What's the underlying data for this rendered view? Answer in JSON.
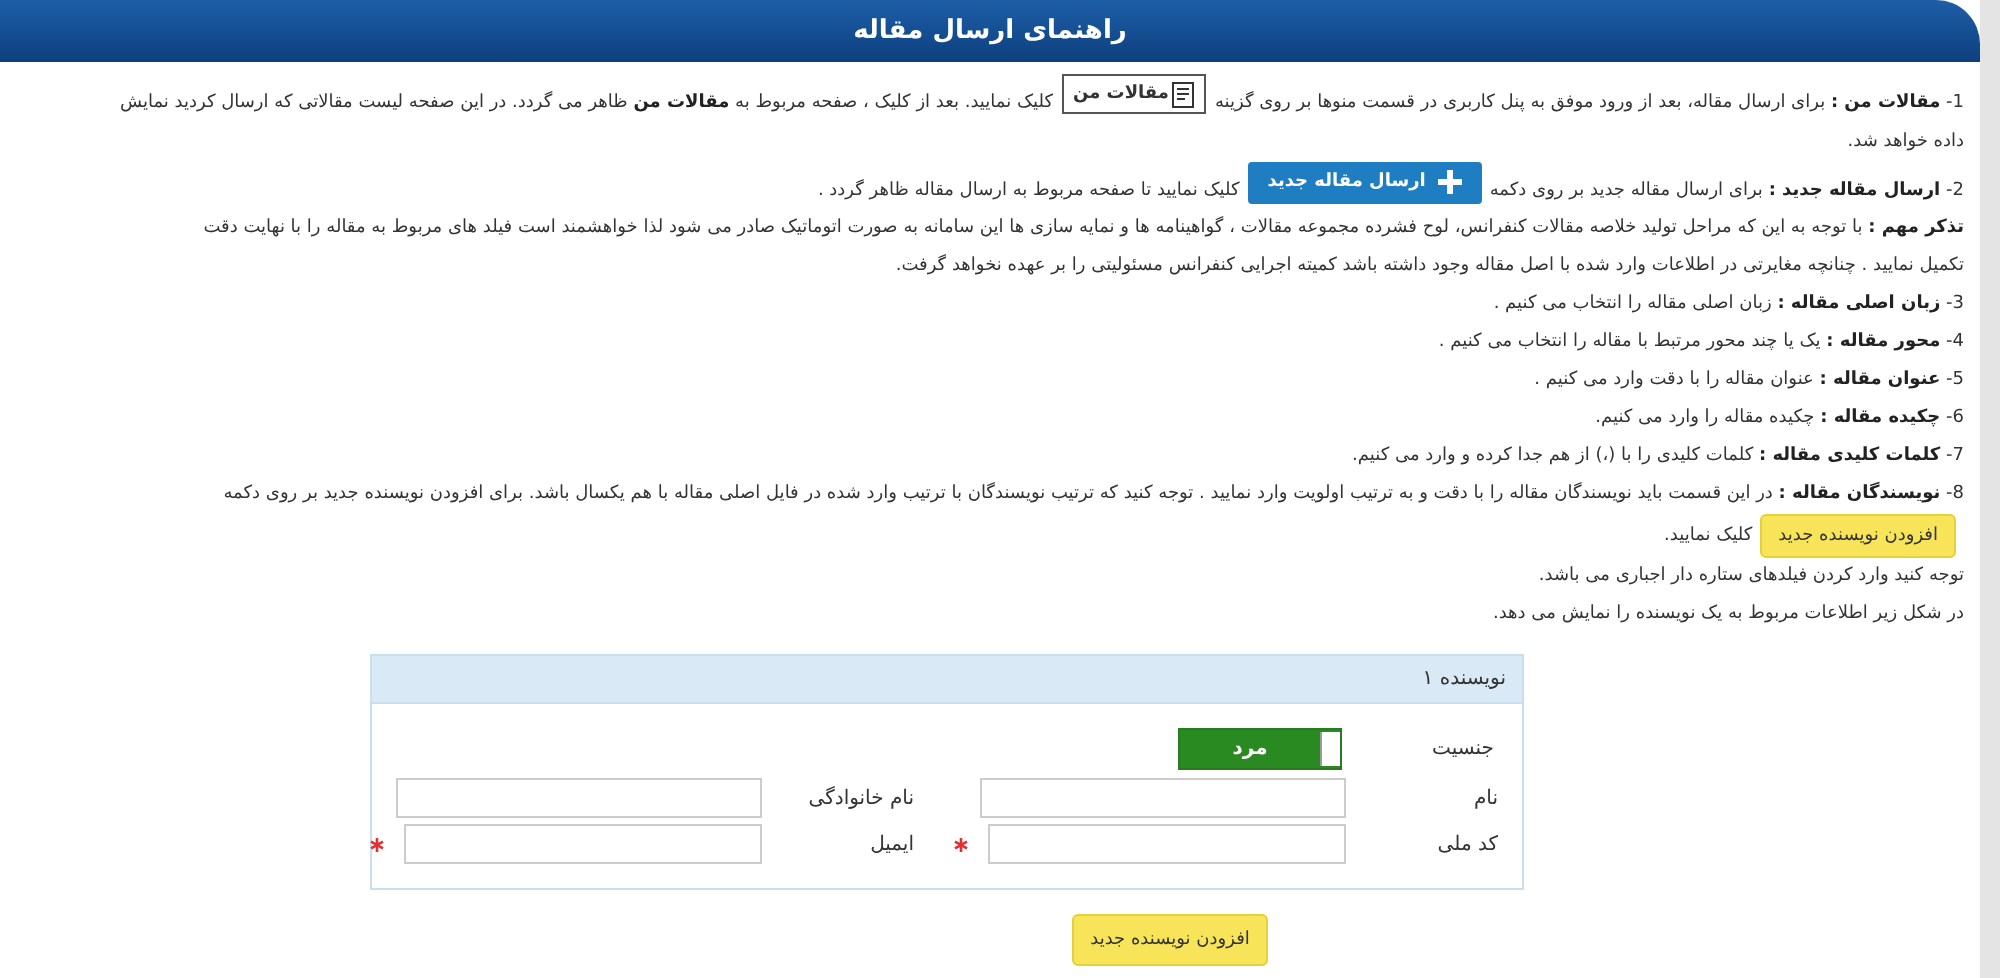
{
  "header": {
    "title": "راهنمای ارسال مقاله"
  },
  "paragraphs": [
    {
      "parts": [
        {
          "kind": "text",
          "text": "1- **مقالات من :** برای ارسال مقاله، بعد از ورود موفق به پنل کاربری در قسمت منوها بر روی گزینه"
        },
        {
          "kind": "menu-button",
          "text": "مقالات من"
        },
        {
          "kind": "text",
          "text": "کلیک نمایید. بعد از کلیک ، صفحه مربوط به **مقالات من** ظاهر می گردد. در این صفحه لیست مقالاتی که ارسال کردید نمایش"
        },
        {
          "kind": "break"
        },
        {
          "kind": "text",
          "text": "داده خواهد شد."
        }
      ]
    },
    {
      "parts": [
        {
          "kind": "text",
          "text": "2- **ارسال مقاله جدید :** برای ارسال مقاله جدید بر روی دکمه"
        },
        {
          "kind": "primary-button",
          "text": "ارسال مقاله جدید"
        },
        {
          "kind": "text",
          "text": "کلیک نمایید تا صفحه مربوط به ارسال مقاله ظاهر گردد ."
        }
      ]
    },
    {
      "parts": [
        {
          "kind": "text",
          "text": "**تذکر مهم :** با توجه به این که مراحل تولید خلاصه مقالات کنفرانس، لوح فشرده مجموعه مقالات ، گواهینامه ها و نمایه سازی ها این سامانه به صورت اتوماتیک صادر می شود لذا خواهشمند است فیلد های مربوط به مقاله را با نهایت دقت"
        },
        {
          "kind": "break"
        },
        {
          "kind": "text",
          "text": "تکمیل نمایید . چنانچه مغایرتی در اطلاعات وارد شده با اصل مقاله وجود داشته باشد کمیته اجرایی کنفرانس مسئولیتی را بر عهده نخواهد گرفت."
        }
      ]
    },
    {
      "parts": [
        {
          "kind": "text",
          "text": "3- **زبان اصلی مقاله :** زبان اصلی مقاله را انتخاب می کنیم ."
        }
      ]
    },
    {
      "parts": [
        {
          "kind": "text",
          "text": "4- **محور مقاله :** یک یا چند محور مرتبط با مقاله را انتخاب می کنیم ."
        }
      ]
    },
    {
      "parts": [
        {
          "kind": "text",
          "text": "5- **عنوان مقاله :** عنوان مقاله را با دقت وارد می کنیم ."
        }
      ]
    },
    {
      "parts": [
        {
          "kind": "text",
          "text": "6- **چکیده مقاله :** چکیده مقاله را وارد می کنیم."
        }
      ]
    },
    {
      "parts": [
        {
          "kind": "text",
          "text": "7- **کلمات کلیدی مقاله :** کلمات کلیدی را با (،) از هم جدا کرده و وارد می کنیم."
        }
      ]
    },
    {
      "parts": [
        {
          "kind": "text",
          "text": "8- **نویسندگان مقاله :** در این قسمت باید نویسندگان مقاله را با دقت و به ترتیب اولویت وارد نمایید . توجه کنید که ترتیب نویسندگان با ترتیب وارد شده در فایل اصلی مقاله با هم یکسال باشد. برای افزودن نویسنده جدید بر روی دکمه"
        },
        {
          "kind": "break"
        },
        {
          "kind": "warning-button",
          "text": "افزودن نویسنده جدید"
        },
        {
          "kind": "text",
          "text": "کلیک نمایید."
        }
      ]
    },
    {
      "parts": [
        {
          "kind": "text",
          "text": "توجه کنید وارد کردن فیلدهای ستاره دار اجباری می باشد."
        }
      ]
    },
    {
      "parts": [
        {
          "kind": "text",
          "text": "در شکل زیر اطلاعات مربوط به یک نویسنده را نمایش می دهد."
        }
      ]
    }
  ],
  "author_panel": {
    "title": "نویسنده ۱",
    "gender": {
      "label": "جنسیت",
      "value": "مرد",
      "on": true
    },
    "fields": [
      {
        "label": "نام",
        "required": false
      },
      {
        "label": "نام خانوادگی",
        "required": false
      },
      {
        "label": "کد ملی",
        "required": true
      },
      {
        "label": "ایمیل",
        "required": true
      }
    ]
  },
  "add_author_button": "افزودن نویسنده جدید"
}
